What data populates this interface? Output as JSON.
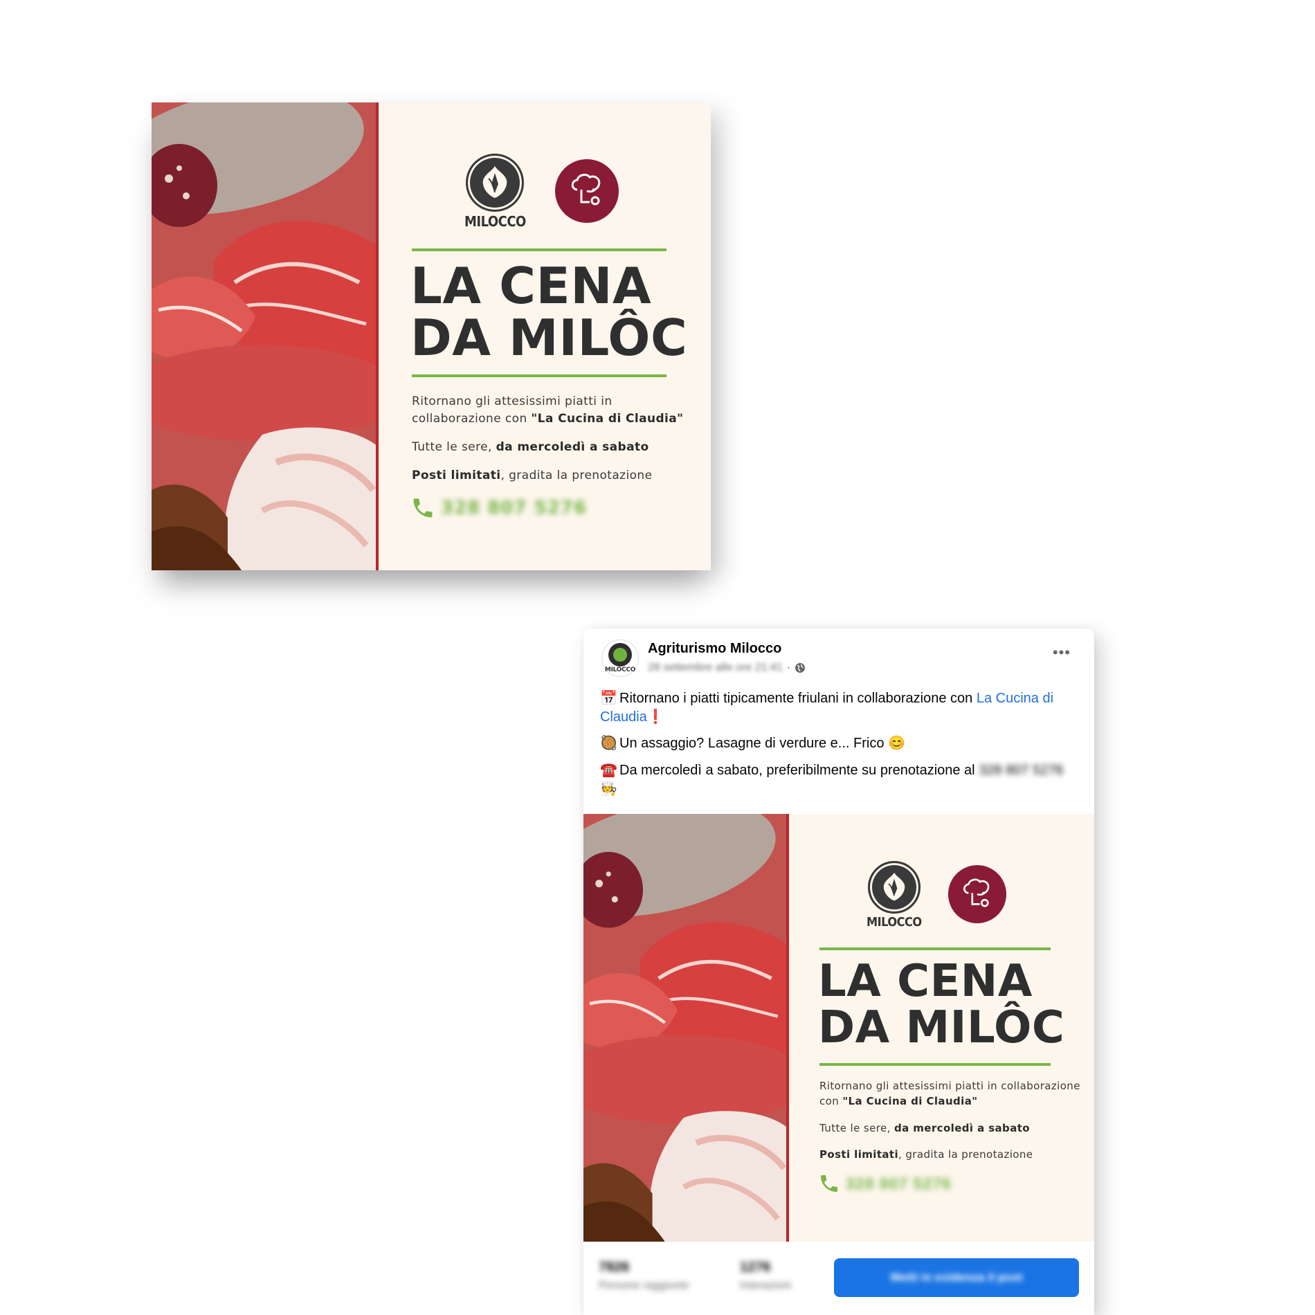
{
  "flyer": {
    "logo_left_text": "MILOCCO",
    "title_line1": "LA CENA",
    "title_line2": "DA MILÔC",
    "para1_plain": "Ritornano gli attesissimi piatti in collaborazione con ",
    "para1_bold": "\"La Cucina di Claudia\"",
    "para2_plain": "Tutte le sere, ",
    "para2_bold": "da mercoledì a sabato",
    "para3_bold": "Posti limitati",
    "para3_plain": ", gradita la prenotazione",
    "phone_number": "328 807 5276",
    "colors": {
      "accent_green": "#7ab648",
      "claudia_red": "#8a1b34",
      "divider_red": "#b8272a",
      "cream": "#fcf6ec"
    }
  },
  "post": {
    "page_name": "Agriturismo Milocco",
    "date": "28 settembre alle ore 21:41",
    "avatar_text": "MILOCCO",
    "line1_emoji": "📅",
    "line1_text": "Ritornano i piatti tipicamente friulani in collaborazione con ",
    "line1_link": "La Cucina di Claudia",
    "line1_end": "❗",
    "line2_emoji": "🥘",
    "line2_text": "Un assaggio? Lasagne di verdure e... Frico ",
    "line2_end": "😊",
    "line3_emoji": "☎️",
    "line3_text": "Da mercoledì a sabato, preferibilmente su prenotazione al ",
    "line3_phone": "328 807 5276",
    "line3_end": "🧑‍🍳",
    "stat1_num": "7826",
    "stat1_label": "Persone raggiunte",
    "stat2_num": "1276",
    "stat2_label": "Interazioni",
    "boost_label": "Metti in evidenza il post"
  }
}
